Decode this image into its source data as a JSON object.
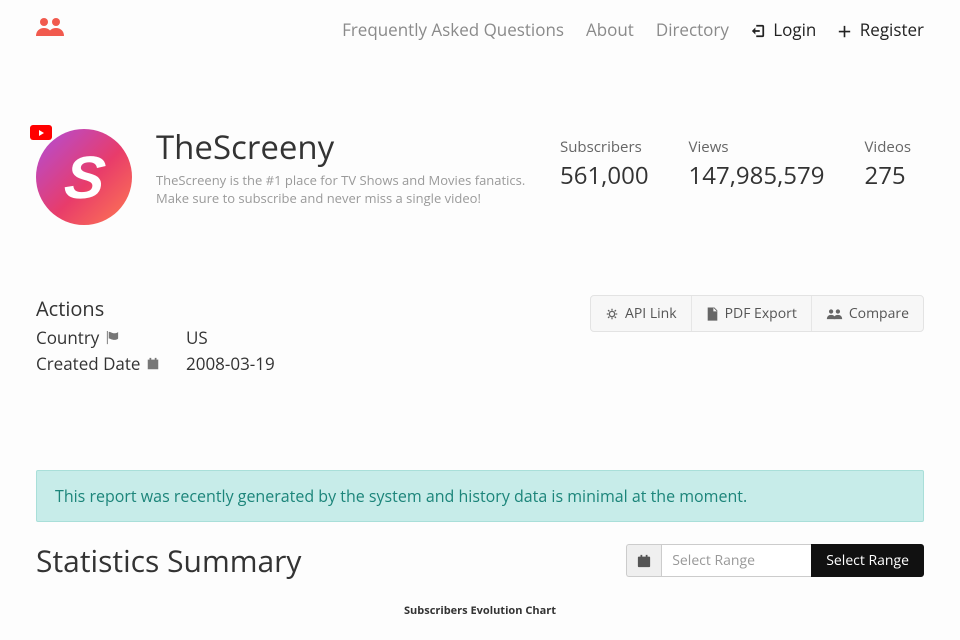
{
  "nav": {
    "faq": "Frequently Asked Questions",
    "about": "About",
    "directory": "Directory",
    "login": "Login",
    "register": "Register"
  },
  "profile": {
    "name": "TheScreeny",
    "tagline": "TheScreeny is the #1 place for TV Shows and Movies fanatics. Make sure to subscribe and never miss a single video!"
  },
  "stats": {
    "subs_label": "Subscribers",
    "subs_value": "561,000",
    "views_label": "Views",
    "views_value": "147,985,579",
    "videos_label": "Videos",
    "videos_value": "275"
  },
  "actions": {
    "heading": "Actions",
    "country_label": "Country",
    "country_value": "US",
    "created_label": "Created Date",
    "created_value": "2008-03-19",
    "api_link": "API Link",
    "pdf_export": "PDF Export",
    "compare": "Compare"
  },
  "notice": "This report was recently generated by the system and history data is minimal at the moment.",
  "summary": {
    "heading": "Statistics Summary",
    "range_placeholder": "Select Range",
    "select_range": "Select Range"
  },
  "chart": {
    "title": "Subscribers Evolution Chart"
  }
}
